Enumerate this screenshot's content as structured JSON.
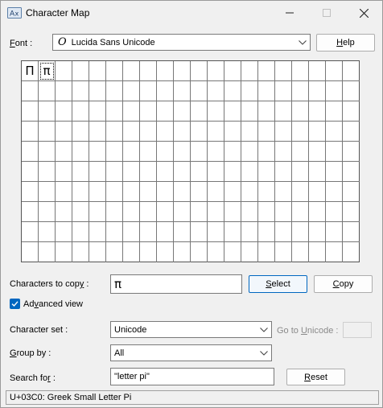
{
  "window": {
    "title": "Character Map",
    "app_icon": "charmap-icon",
    "controls": [
      "minimize-icon",
      "maximize-icon",
      "close-icon"
    ]
  },
  "font": {
    "label_prefix": "F",
    "label_rest": "ont :",
    "selected": "Lucida Sans Unicode",
    "font_type_icon": "opentype-font-icon"
  },
  "help_button": {
    "underlined": "H",
    "rest": "elp"
  },
  "grid": {
    "columns": 20,
    "rows": 10,
    "characters": [
      "Π",
      "π"
    ],
    "selected_index": 1
  },
  "copy": {
    "label_prefix": "Characters to cop",
    "label_underlined": "y",
    "label_suffix": " :",
    "value": "π",
    "select_underlined": "S",
    "select_rest": "elect",
    "copy_underlined": "C",
    "copy_rest": "opy"
  },
  "advanced_view": {
    "label_prefix": "Ad",
    "label_underlined": "v",
    "label_rest": "anced view",
    "checked": true
  },
  "character_set": {
    "label": "Character set :",
    "value": "Unicode"
  },
  "goto_unicode": {
    "label_prefix": "Go to ",
    "label_underlined": "U",
    "label_rest": "nicode :",
    "value": ""
  },
  "group_by": {
    "label_underlined": "G",
    "label_rest": "roup by :",
    "value": "All"
  },
  "search": {
    "label_prefix": "Search fo",
    "label_underlined": "r",
    "label_suffix": " :",
    "value": "\"letter pi\"",
    "reset_underlined": "R",
    "reset_rest": "eset"
  },
  "status": {
    "text": "U+03C0: Greek Small Letter Pi"
  }
}
